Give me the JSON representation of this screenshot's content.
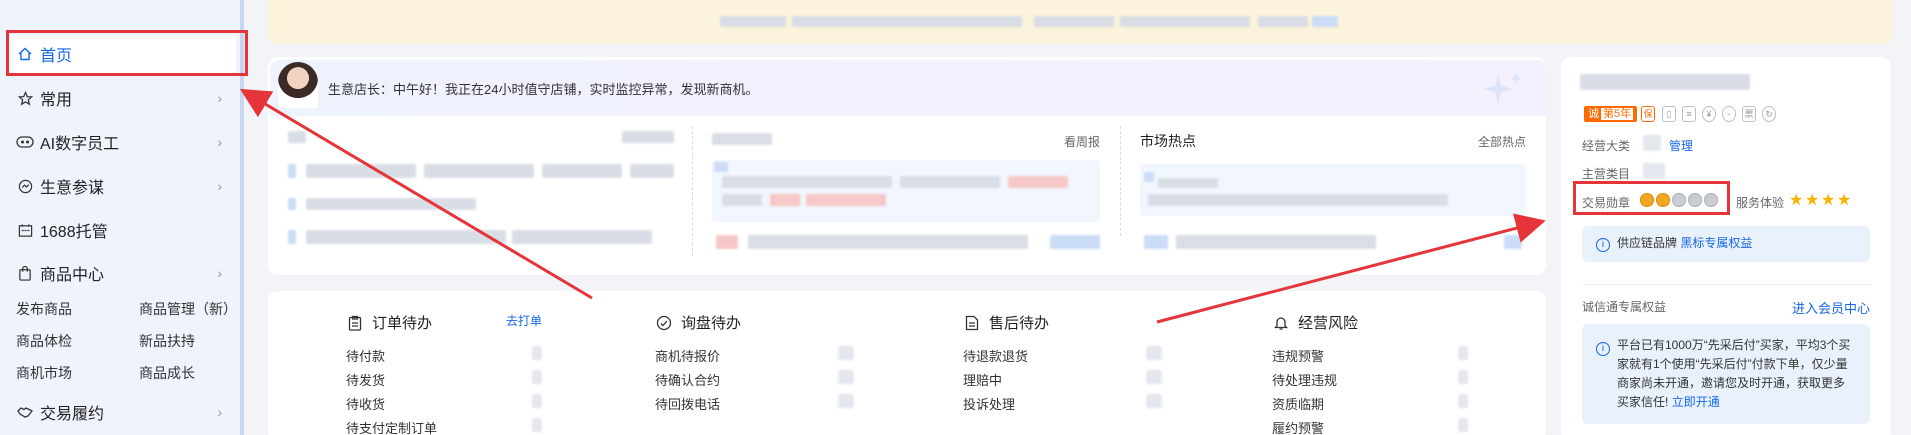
{
  "sidebar": {
    "items": [
      {
        "label": "首页",
        "icon": "home-icon"
      },
      {
        "label": "常用",
        "icon": "star-icon"
      },
      {
        "label": "AI数字员工",
        "icon": "robot-icon"
      },
      {
        "label": "生意参谋",
        "icon": "gauge-icon"
      },
      {
        "label": "1688托管",
        "icon": "calendar-icon"
      },
      {
        "label": "商品中心",
        "icon": "bag-icon"
      },
      {
        "label": "交易履约",
        "icon": "handshake-icon"
      }
    ],
    "sub_items": [
      "发布商品",
      "商品管理（新）",
      "商品体检",
      "新品扶持",
      "商机市场",
      "商品成长"
    ]
  },
  "assistant": {
    "greeting": "生意店长：中午好！我正在24小时值守店铺，实时监控异常，发现新商机。"
  },
  "sections": {
    "weekly_link": "看周报",
    "market_title": "市场热点",
    "market_link": "全部热点"
  },
  "todo": {
    "orders": {
      "title": "订单待办",
      "link": "去打单",
      "items": [
        "待付款",
        "待发货",
        "待收货",
        "待支付定制订单"
      ]
    },
    "inquiry": {
      "title": "询盘待办",
      "items": [
        "商机待报价",
        "待确认合约",
        "待回拨电话"
      ]
    },
    "after_sale": {
      "title": "售后待办",
      "items": [
        "待退款退货",
        "理赔中",
        "投诉处理"
      ]
    },
    "risk": {
      "title": "经营风险",
      "items": [
        "违规预警",
        "待处理违规",
        "资质临期",
        "履约预警"
      ]
    }
  },
  "right_panel": {
    "badge_label": "诚",
    "badge_years": "第5年",
    "main_category_label": "经营大类",
    "manage_link": "管理",
    "main_item_label": "主营类目",
    "trade_medal_label": "交易勋章",
    "service_label": "服务体验",
    "service_stars": 4,
    "supply_label": "供应链品牌",
    "supply_link": "黑标专属权益",
    "cxt_label": "诚信通专属权益",
    "member_link": "进入会员中心",
    "notice_text": "平台已有1000万“先采后付”买家，平均3个买家就有1个使用“先采后付”付款下单，仅少量商家尚未开通，邀请您及时开通，获取更多买家信任!",
    "notice_link": "立即开通"
  },
  "colors": {
    "accent": "#1767e9",
    "annotation_red": "#e5343a",
    "sidebar_bg": "#eef3fc",
    "banner_bg": "#fbf3dc"
  }
}
